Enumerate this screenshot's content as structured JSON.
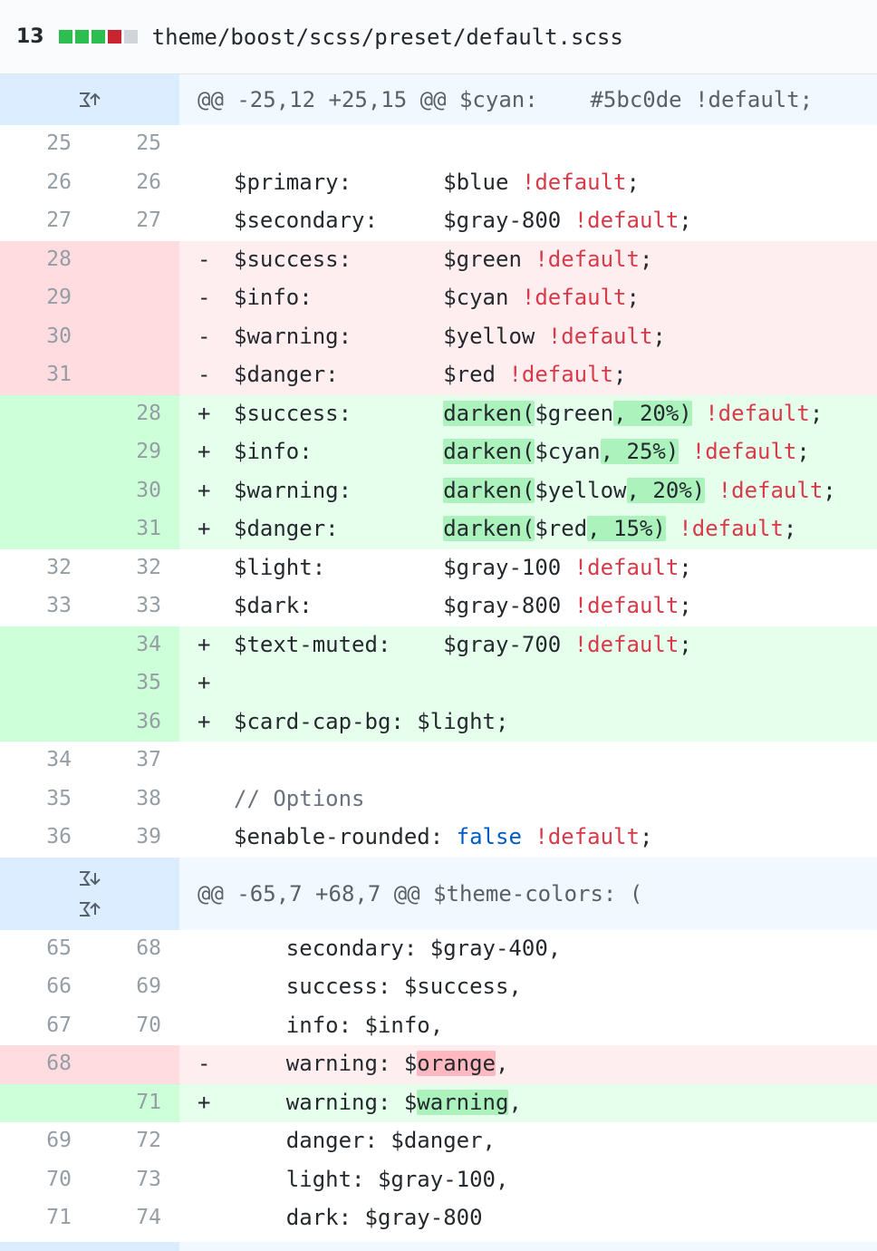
{
  "file": {
    "diffstat_count": "13",
    "diffstat_blocks": [
      "add",
      "add",
      "add",
      "del",
      "neutral"
    ],
    "path": "theme/boost/scss/preset/default.scss"
  },
  "hunks": [
    "@@ -25,12 +25,15 @@ $cyan:    #5bc0de !default;",
    "@@ -65,7 +68,7 @@ $theme-colors: ("
  ],
  "lines": {
    "l1": {
      "old": "25",
      "new": "25"
    },
    "l2": {
      "old": "26",
      "new": "26",
      "name": "$primary:",
      "pad": "       ",
      "val": "$blue",
      "flag": "!default",
      "end": ";"
    },
    "l3": {
      "old": "27",
      "new": "27",
      "name": "$secondary:",
      "pad": "     ",
      "val": "$gray-800",
      "flag": "!default",
      "end": ";"
    },
    "l4": {
      "old": "28",
      "new": "",
      "mark": "-",
      "name": "$success:",
      "pad": "       ",
      "val": "$green",
      "flag": "!default",
      "end": ";"
    },
    "l5": {
      "old": "29",
      "new": "",
      "mark": "-",
      "name": "$info:",
      "pad": "          ",
      "val": "$cyan",
      "flag": "!default",
      "end": ";"
    },
    "l6": {
      "old": "30",
      "new": "",
      "mark": "-",
      "name": "$warning:",
      "pad": "       ",
      "val": "$yellow",
      "flag": "!default",
      "end": ";"
    },
    "l7": {
      "old": "31",
      "new": "",
      "mark": "-",
      "name": "$danger:",
      "pad": "        ",
      "val": "$red",
      "flag": "!default",
      "end": ";"
    },
    "l8": {
      "old": "",
      "new": "28",
      "mark": "+",
      "name": "$success:",
      "pad": "       ",
      "fn": "darken(",
      "arg": "$green",
      "amt": ", 20%)",
      "flag": "!default",
      "end": ";"
    },
    "l9": {
      "old": "",
      "new": "29",
      "mark": "+",
      "name": "$info:",
      "pad": "          ",
      "fn": "darken(",
      "arg": "$cyan",
      "amt": ", 25%)",
      "flag": "!default",
      "end": ";"
    },
    "l10": {
      "old": "",
      "new": "30",
      "mark": "+",
      "name": "$warning:",
      "pad": "       ",
      "fn": "darken(",
      "arg": "$yellow",
      "amt": ", 20%)",
      "flag": "!default",
      "end": ";"
    },
    "l11": {
      "old": "",
      "new": "31",
      "mark": "+",
      "name": "$danger:",
      "pad": "        ",
      "fn": "darken(",
      "arg": "$red",
      "amt": ", 15%)",
      "flag": "!default",
      "end": ";"
    },
    "l12": {
      "old": "32",
      "new": "32",
      "name": "$light:",
      "pad": "         ",
      "val": "$gray-100",
      "flag": "!default",
      "end": ";"
    },
    "l13": {
      "old": "33",
      "new": "33",
      "name": "$dark:",
      "pad": "          ",
      "val": "$gray-800",
      "flag": "!default",
      "end": ";"
    },
    "l14": {
      "old": "",
      "new": "34",
      "mark": "+",
      "name": "$text-muted:",
      "pad": "    ",
      "val": "$gray-700",
      "flag": "!default",
      "end": ";"
    },
    "l15": {
      "old": "",
      "new": "35",
      "mark": "+"
    },
    "l16": {
      "old": "",
      "new": "36",
      "mark": "+",
      "text": "$card-cap-bg: $light;"
    },
    "l17": {
      "old": "34",
      "new": "37"
    },
    "l18": {
      "old": "35",
      "new": "38",
      "comment": "// Options"
    },
    "l19": {
      "old": "36",
      "new": "39",
      "name": "$enable-rounded: ",
      "bool": "false",
      "flag": "!default",
      "end": ";"
    },
    "m1": {
      "old": "65",
      "new": "68",
      "text": "    secondary: $gray-400,"
    },
    "m2": {
      "old": "66",
      "new": "69",
      "text": "    success: $success,"
    },
    "m3": {
      "old": "67",
      "new": "70",
      "text": "    info: $info,"
    },
    "m4": {
      "old": "68",
      "new": "",
      "mark": "-",
      "pre": "    warning: $",
      "hl": "orange",
      "post": ","
    },
    "m5": {
      "old": "",
      "new": "71",
      "mark": "+",
      "pre": "    warning: $",
      "hl": "warning",
      "post": ","
    },
    "m6": {
      "old": "69",
      "new": "72",
      "text": "    danger: $danger,"
    },
    "m7": {
      "old": "70",
      "new": "73",
      "text": "    light: $gray-100,"
    },
    "m8": {
      "old": "71",
      "new": "74",
      "text": "    dark: $gray-800"
    }
  },
  "icons": {
    "expand_up": "unfold-up-icon",
    "expand_down": "unfold-down-icon"
  },
  "colors": {
    "add_block": "#2cbe4e",
    "del_block": "#cb2431",
    "keyword": "#d73a49",
    "boolean": "#005cc5",
    "hunk_bg": "#f1f8ff",
    "add_bg": "#e6ffed",
    "del_bg": "#ffeef0"
  }
}
